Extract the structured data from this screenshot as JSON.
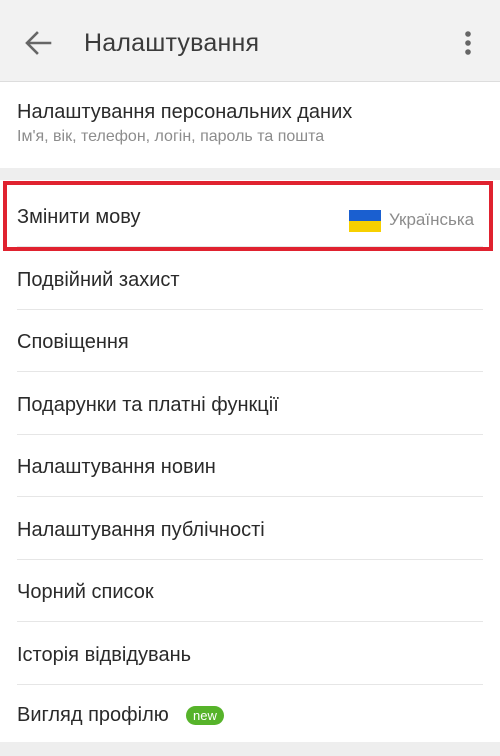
{
  "header": {
    "title": "Налаштування",
    "back_icon": "arrow-left-icon",
    "menu_icon": "more-vertical-icon"
  },
  "personal": {
    "title": "Налаштування персональних даних",
    "subtitle": "Ім'я, вік, телефон, логін, пароль та пошта"
  },
  "settings": [
    {
      "label": "Змінити мову",
      "value": "Українська",
      "flag": "ukraine-flag-icon"
    },
    {
      "label": "Подвійний захист"
    },
    {
      "label": "Сповіщення"
    },
    {
      "label": "Подарунки та платні функції"
    },
    {
      "label": "Налаштування новин"
    },
    {
      "label": "Налаштування публічності"
    },
    {
      "label": "Чорний список"
    },
    {
      "label": "Історія відвідувань"
    },
    {
      "label": "Вигляд профілю",
      "badge": "new"
    }
  ],
  "colors": {
    "highlight_border": "#e0222f",
    "badge_new": "#56b32a",
    "flag_blue": "#1a5fd0",
    "flag_yellow": "#f7d000"
  }
}
